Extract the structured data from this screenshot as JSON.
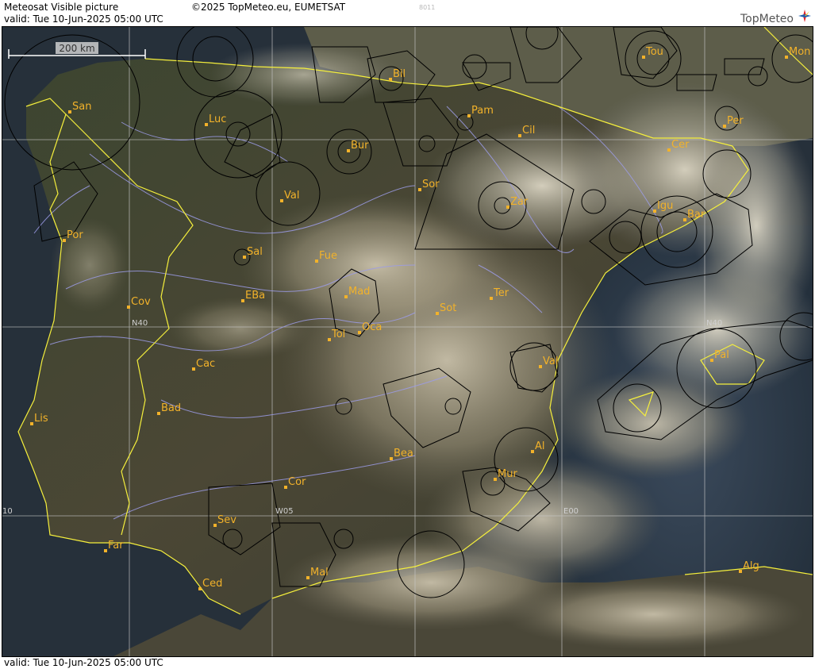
{
  "header": {
    "title": "Meteosat Visible picture",
    "copyright": "©2025 TopMeteo.eu, EUMETSAT",
    "valid": "valid:  Tue  10-Jun-2025  05:00 UTC",
    "code": "8011",
    "logo_text": "TopMeteo"
  },
  "footer": {
    "valid": "valid:  Tue  10-Jun-2025  05:00 UTC"
  },
  "scale_label": "200 km",
  "grid_labels": [
    "N40",
    "N40",
    "W05",
    "E00",
    "10"
  ],
  "cities": [
    {
      "name": "San"
    },
    {
      "name": "Luc"
    },
    {
      "name": "Bur"
    },
    {
      "name": "Bil"
    },
    {
      "name": "Pam"
    },
    {
      "name": "Cil"
    },
    {
      "name": "Zar"
    },
    {
      "name": "Sor"
    },
    {
      "name": "Val"
    },
    {
      "name": "Por"
    },
    {
      "name": "Sal"
    },
    {
      "name": "Fue"
    },
    {
      "name": "Mad"
    },
    {
      "name": "Cov"
    },
    {
      "name": "EBa"
    },
    {
      "name": "Ter"
    },
    {
      "name": "Sot"
    },
    {
      "name": "Tol"
    },
    {
      "name": "Oca"
    },
    {
      "name": "Cac"
    },
    {
      "name": "Val"
    },
    {
      "name": "Bad"
    },
    {
      "name": "Lis"
    },
    {
      "name": "Bea"
    },
    {
      "name": "Al"
    },
    {
      "name": "Mur"
    },
    {
      "name": "Cor"
    },
    {
      "name": "Sev"
    },
    {
      "name": "Far"
    },
    {
      "name": "Mal"
    },
    {
      "name": "Ced"
    },
    {
      "name": "Alg"
    },
    {
      "name": "Tou"
    },
    {
      "name": "Mon"
    },
    {
      "name": "Per"
    },
    {
      "name": "Cer"
    },
    {
      "name": "Igu"
    },
    {
      "name": "Bar"
    },
    {
      "name": "Pal"
    }
  ],
  "colors": {
    "city_label": "#f2b22a",
    "coastline": "#f5ef3c",
    "river": "#9c9ce8",
    "grid": "#c8c8c8",
    "airspace": "#000000"
  }
}
